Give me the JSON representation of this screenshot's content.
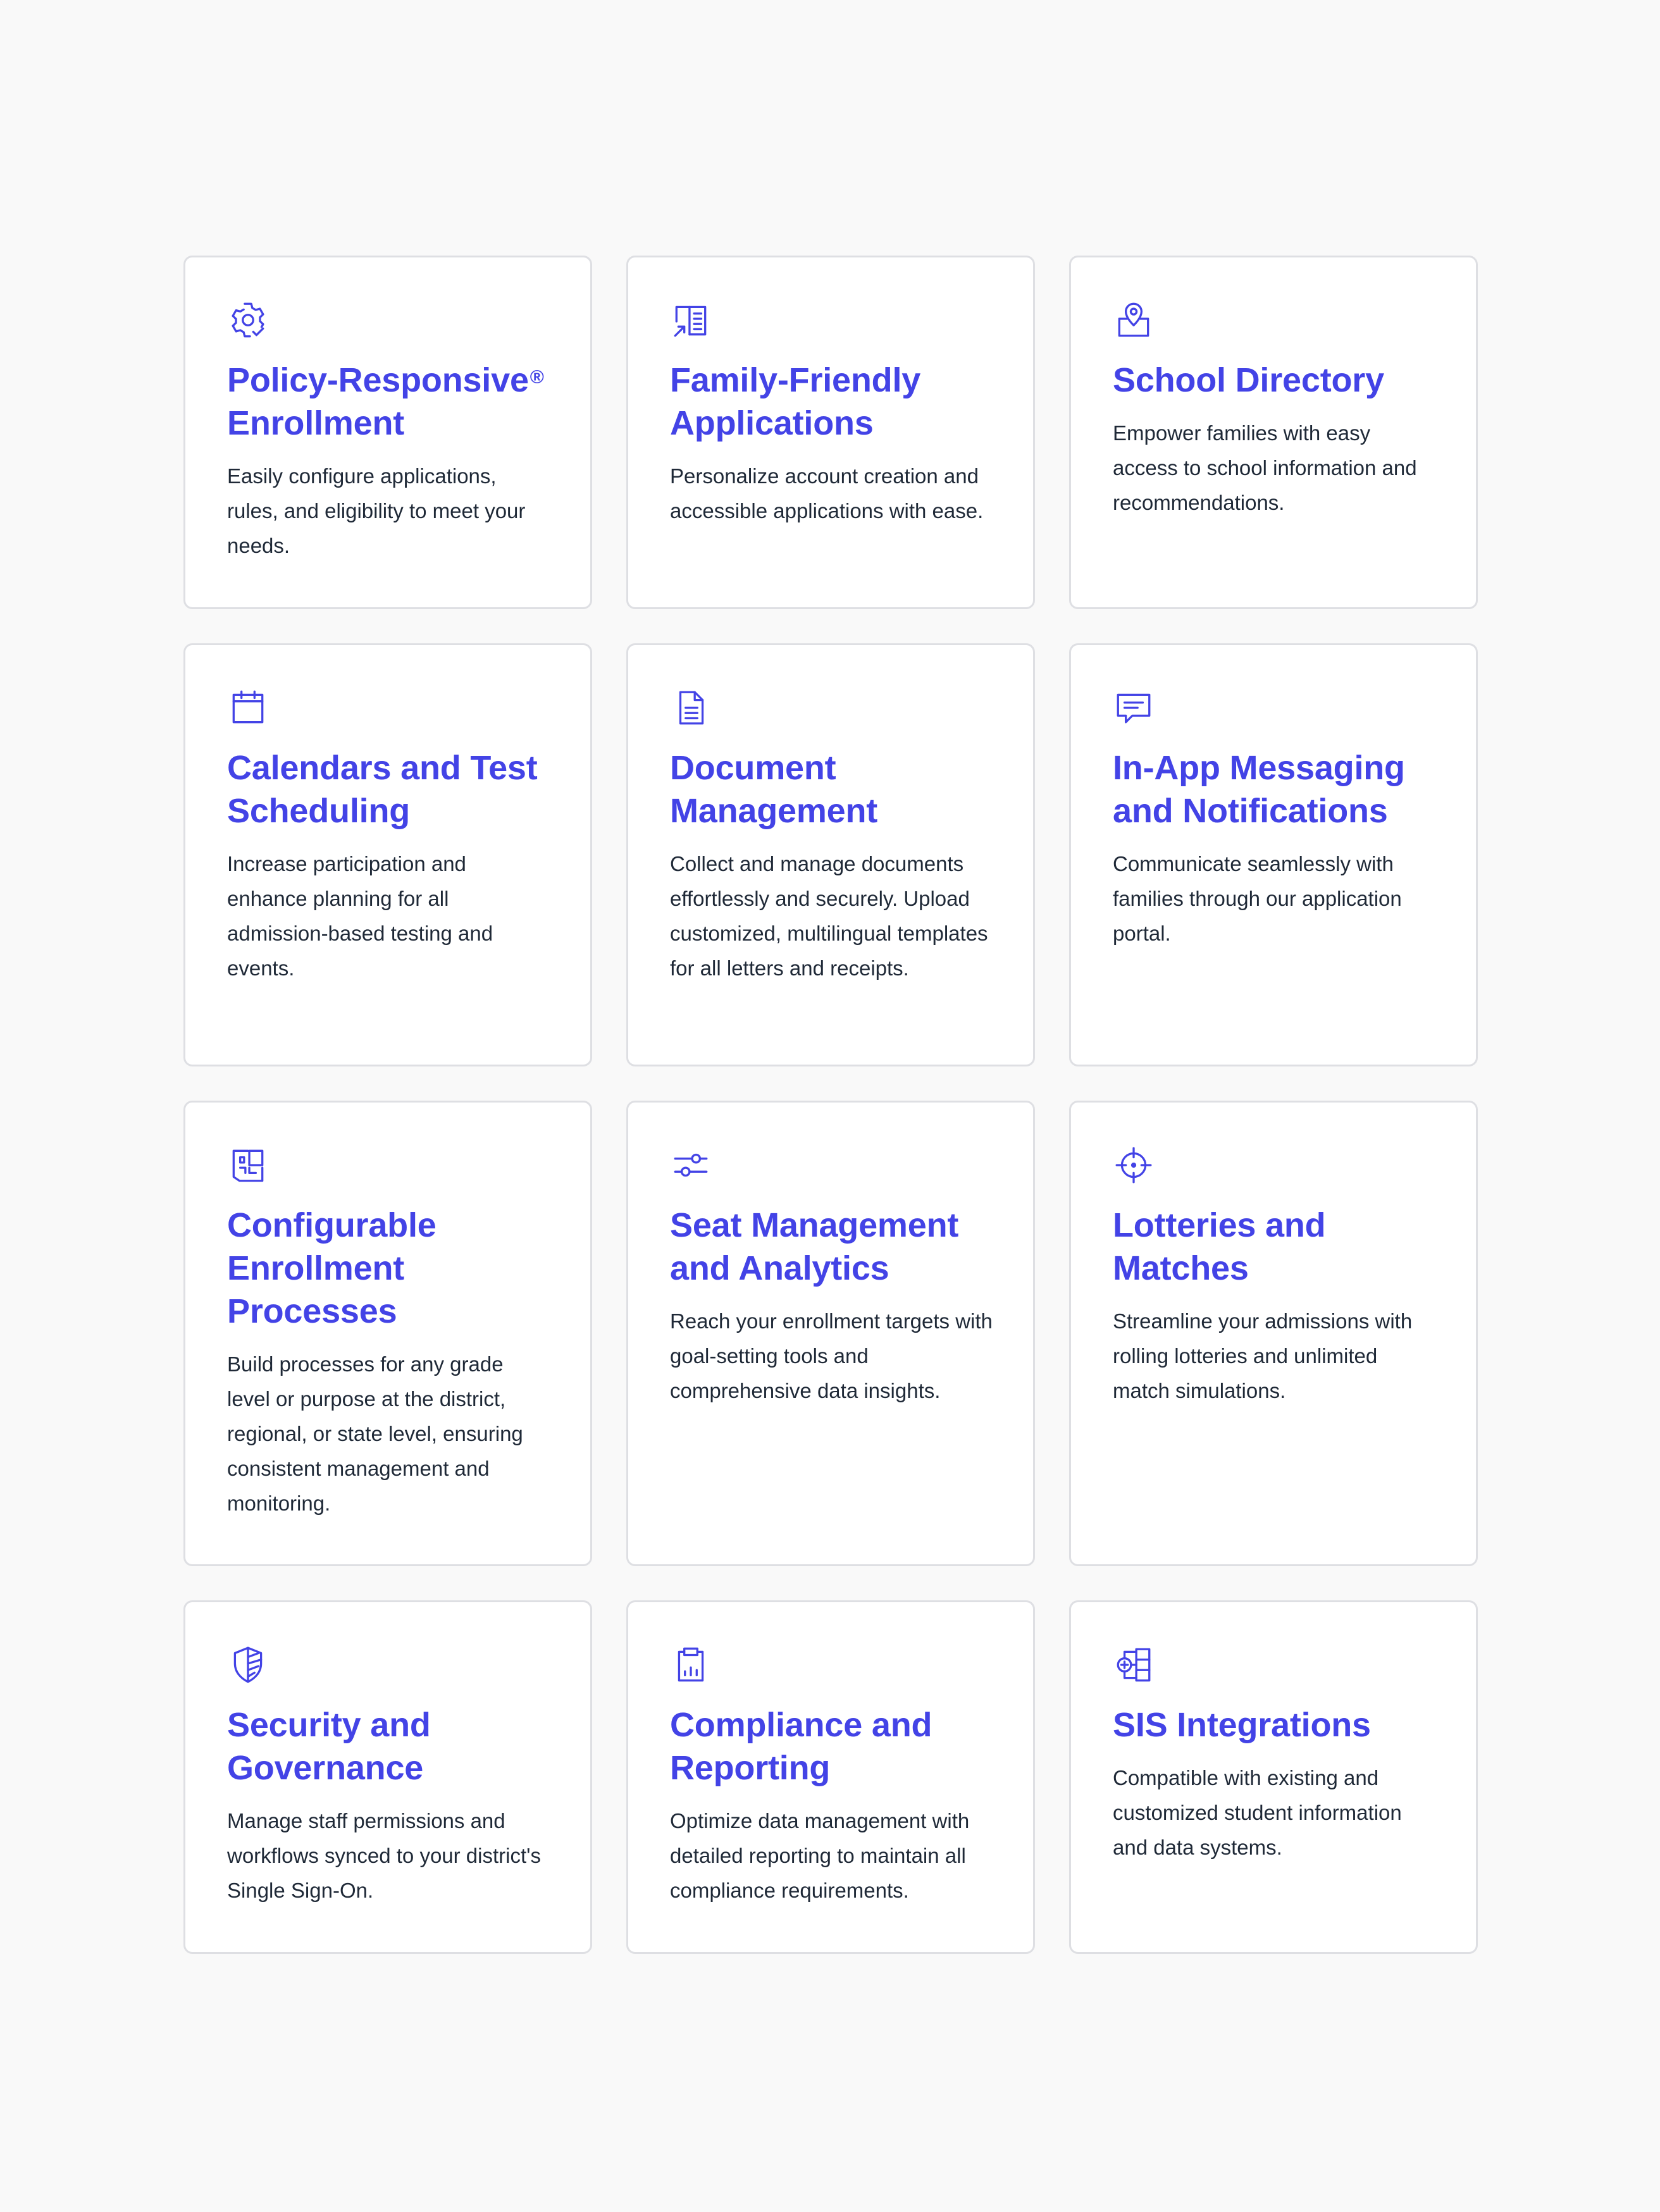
{
  "colors": {
    "accent": "#4343e6",
    "text": "#1f2937",
    "border": "#dedfe3",
    "background": "#f9f9f9",
    "card": "#ffffff"
  },
  "cards": [
    {
      "icon": "gear-check-icon",
      "title": "Policy-Responsive",
      "title_mark": "®",
      "title_line2": "Enrollment",
      "description": "Easily configure applications, rules, and eligibility to meet your needs."
    },
    {
      "icon": "form-arrow-icon",
      "title": "Family-Friendly Applications",
      "description": "Personalize account creation and accessible applications with ease."
    },
    {
      "icon": "map-pin-icon",
      "title": "School Directory",
      "description": "Empower families with easy access to school information and recommendations."
    },
    {
      "icon": "calendar-icon",
      "title": "Calendars and Test Scheduling",
      "description": "Increase participation and enhance planning for all admission-based testing and events."
    },
    {
      "icon": "document-icon",
      "title": "Document Management",
      "description": "Collect and manage documents effortlessly and securely. Upload customized, multilingual templates for all letters and receipts."
    },
    {
      "icon": "chat-icon",
      "title": "In-App Messaging and Notifications",
      "description": "Communicate seamlessly with families through our application portal."
    },
    {
      "icon": "blueprint-icon",
      "title": "Configurable Enrollment Processes",
      "description": "Build processes for any grade level or purpose at the district, regional, or state level, ensuring consistent management and monitoring."
    },
    {
      "icon": "sliders-icon",
      "title": "Seat Management and Analytics",
      "description": "Reach your enrollment targets with goal-setting tools and comprehensive data insights."
    },
    {
      "icon": "crosshair-icon",
      "title": "Lotteries and Matches",
      "description": "Streamline your admissions with rolling lotteries and unlimited match simulations."
    },
    {
      "icon": "shield-icon",
      "title": "Security and Governance",
      "description": "Manage staff permissions and workflows synced to your district's Single Sign-On."
    },
    {
      "icon": "clipboard-chart-icon",
      "title": "Compliance and Reporting",
      "description": "Optimize data management with detailed reporting to maintain all compliance requirements."
    },
    {
      "icon": "integration-icon",
      "title": "SIS Integrations",
      "description": "Compatible with existing and customized student information and data systems."
    }
  ]
}
